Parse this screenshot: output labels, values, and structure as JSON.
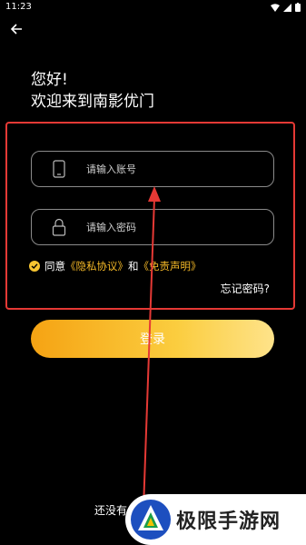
{
  "status_bar": {
    "time": "11:23"
  },
  "greeting": {
    "line1": "您好!",
    "line2": "欢迎来到南影优门"
  },
  "account_field": {
    "placeholder": "请输入账号",
    "icon": "phone-icon"
  },
  "password_field": {
    "placeholder": "请输入密码",
    "icon": "lock-icon"
  },
  "agreement": {
    "prefix": "同意",
    "privacy": "《隐私协议》",
    "and": "和",
    "disclaimer": "《免责声明》",
    "checked": true
  },
  "forgot_password": "忘记密码?",
  "login_button": "登录",
  "register_hint": "还没有",
  "watermark": {
    "text": "极限手游网"
  },
  "colors": {
    "accent": "#f5b927",
    "annotation": "#e53935",
    "background": "#000000"
  }
}
